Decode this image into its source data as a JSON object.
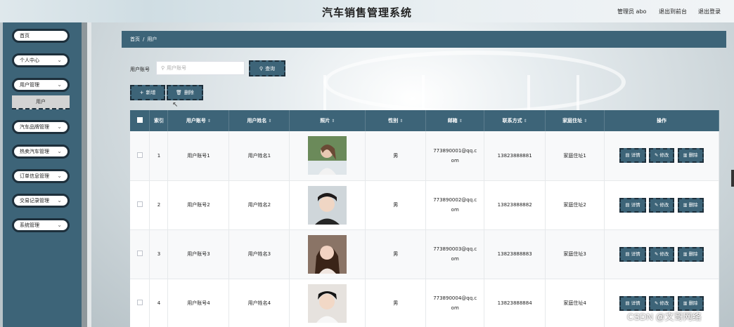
{
  "header": {
    "title": "汽车销售管理系统",
    "admin": "管理员 abo",
    "back_front": "退出到前台",
    "logout": "退出登录"
  },
  "sidebar": {
    "items": [
      {
        "label": "首页"
      },
      {
        "label": "个人中心"
      },
      {
        "label": "用户管理"
      },
      {
        "label": "汽车品牌管理"
      },
      {
        "label": "热卖汽车管理"
      },
      {
        "label": "订单信息管理"
      },
      {
        "label": "交易记录管理"
      },
      {
        "label": "系统管理"
      }
    ],
    "submenu_label": "用户"
  },
  "breadcrumb": {
    "home": "首页",
    "sep": "/",
    "current": "用户"
  },
  "search": {
    "label": "用户账号",
    "placeholder": "用户账号",
    "button": "查询"
  },
  "actions": {
    "add": "新增",
    "delete": "删除"
  },
  "table": {
    "columns": [
      "索引",
      "用户账号",
      "用户姓名",
      "照片",
      "性别",
      "邮箱",
      "联系方式",
      "家庭住址",
      "操作"
    ],
    "rows": [
      {
        "index": "1",
        "account": "用户账号1",
        "name": "用户姓名1",
        "gender": "男",
        "email": "773890001@qq.com",
        "phone": "13823888881",
        "address": "家庭住址1"
      },
      {
        "index": "2",
        "account": "用户账号2",
        "name": "用户姓名2",
        "gender": "男",
        "email": "773890002@qq.com",
        "phone": "13823888882",
        "address": "家庭住址2"
      },
      {
        "index": "3",
        "account": "用户账号3",
        "name": "用户姓名3",
        "gender": "男",
        "email": "773890003@qq.com",
        "phone": "13823888883",
        "address": "家庭住址3"
      },
      {
        "index": "4",
        "account": "用户账号4",
        "name": "用户姓名4",
        "gender": "男",
        "email": "773890004@qq.com",
        "phone": "13823888884",
        "address": "家庭住址4"
      }
    ],
    "op_detail": "详情",
    "op_edit": "修改",
    "op_delete": "删除"
  },
  "watermark": "CSDN @文哥网络",
  "colors": {
    "accent": "#3d6478",
    "dark_border": "#1d2f3b"
  }
}
